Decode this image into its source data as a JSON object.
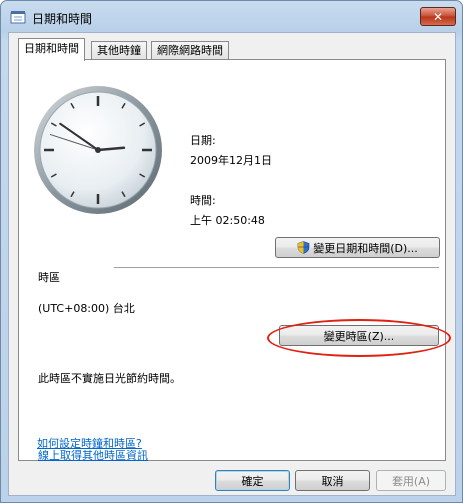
{
  "window": {
    "title": "日期和時間",
    "close_label": "✕"
  },
  "tabs": [
    {
      "label": "日期和時間",
      "active": true
    },
    {
      "label": "其他時鐘",
      "active": false
    },
    {
      "label": "網際網路時間",
      "active": false
    }
  ],
  "clock": {
    "hour": 2,
    "minute": 50,
    "second": 48
  },
  "date_section": {
    "label": "日期:",
    "value": "2009年12月1日"
  },
  "time_section": {
    "label": "時間:",
    "value": "上午 02:50:48"
  },
  "change_datetime_button": "變更日期和時間(D)...",
  "timezone": {
    "heading": "時區",
    "value": "(UTC+08:00) 台北",
    "change_button": "變更時區(Z)..."
  },
  "dst_note": "此時區不實施日光節約時間。",
  "links": {
    "more_info": "線上取得其他時區資訊",
    "how_set": "如何設定時鐘和時區?"
  },
  "footer": {
    "ok": "確定",
    "cancel": "取消",
    "apply": "套用(A)"
  },
  "colors": {
    "accent": "#3c7fb1",
    "link": "#0066cc",
    "highlight": "#e02010"
  }
}
